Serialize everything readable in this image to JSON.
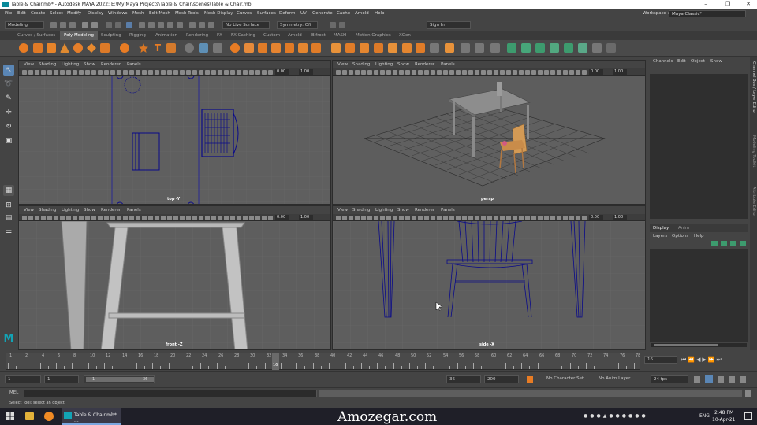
{
  "window": {
    "title": "Table & Chair.mb* - Autodesk MAYA 2022: E:\\My Maya Projects\\Table & Chair\\scenes\\Table & Chair.mb",
    "controls": [
      "–",
      "❐",
      "✕"
    ]
  },
  "menubar": {
    "items": [
      "File",
      "Edit",
      "Create",
      "Select",
      "Modify",
      "Display",
      "Windows",
      "Mesh",
      "Edit Mesh",
      "Mesh Tools",
      "Mesh Display",
      "Curves",
      "Surfaces",
      "Deform",
      "UV",
      "Generate",
      "Cache",
      "Arnold",
      "Help"
    ],
    "workspace_label": "Workspace :",
    "workspace_value": "Maya Classic*"
  },
  "statusline": {
    "menuset": "Modeling",
    "live_surface": "No Live Surface",
    "symmetry": "Symmetry: Off",
    "sign_in": "Sign In"
  },
  "shelf_tabs": [
    "Curves / Surfaces",
    "Poly Modeling",
    "Sculpting",
    "Rigging",
    "Animation",
    "Rendering",
    "FX",
    "FX Caching",
    "Custom",
    "Arnold",
    "Bifrost",
    "MASH",
    "Motion Graphics",
    "XGen"
  ],
  "shelf_active": "Poly Modeling",
  "panel_menu": [
    "View",
    "Shading",
    "Lighting",
    "Show",
    "Renderer",
    "Panels"
  ],
  "panels": [
    {
      "camera": "top -Y",
      "value1": "0.00",
      "value2": "1.00"
    },
    {
      "camera": "persp",
      "value1": "0.00",
      "value2": "1.00"
    },
    {
      "camera": "front -Z",
      "value1": "0.00",
      "value2": "1.00"
    },
    {
      "camera": "side -X",
      "value1": "0.00",
      "value2": "1.00"
    }
  ],
  "channel_box": {
    "menu": [
      "Channels",
      "Edit",
      "Object",
      "Show"
    ],
    "tabs": [
      "Display",
      "Anim"
    ],
    "layer_menu": [
      "Layers",
      "Options",
      "Help"
    ]
  },
  "side_tabs": [
    "Channel Box / Layer Editor",
    "Modeling Toolkit",
    "Attribute Editor"
  ],
  "timeline": {
    "ticks": [
      "1",
      "2",
      "4",
      "6",
      "8",
      "10",
      "12",
      "14",
      "16",
      "18",
      "20",
      "22",
      "24",
      "26",
      "28",
      "30",
      "32",
      "34",
      "36",
      "38",
      "40",
      "42",
      "44",
      "46",
      "48",
      "50",
      "52",
      "54",
      "56",
      "58",
      "60",
      "62",
      "64",
      "66",
      "68",
      "70",
      "72",
      "74",
      "76",
      "78"
    ],
    "current_frame": "16",
    "current_field": "16"
  },
  "range": {
    "start": "1",
    "start2": "1",
    "range_start": "1",
    "range_end": "36",
    "end": "36",
    "end2": "200",
    "character_set": "No Character Set",
    "anim_layer": "No Anim Layer",
    "fps": "24 fps"
  },
  "cmdline": {
    "label": "MEL"
  },
  "helpline": {
    "text": "Select Tool: select an object"
  },
  "taskbar": {
    "app_label": "Table & Chair.mb* ...",
    "watermark": "Amozegar.com",
    "lang": "ENG",
    "time": "2:48 PM",
    "date": "10-Apr-21"
  },
  "colors": {
    "accent": "#1f8fff",
    "wire": "#0a0a8a",
    "shelf_orange": "#e87c24",
    "shelf_green": "#3d9b6e",
    "maya_logo": "#13a3b5"
  }
}
